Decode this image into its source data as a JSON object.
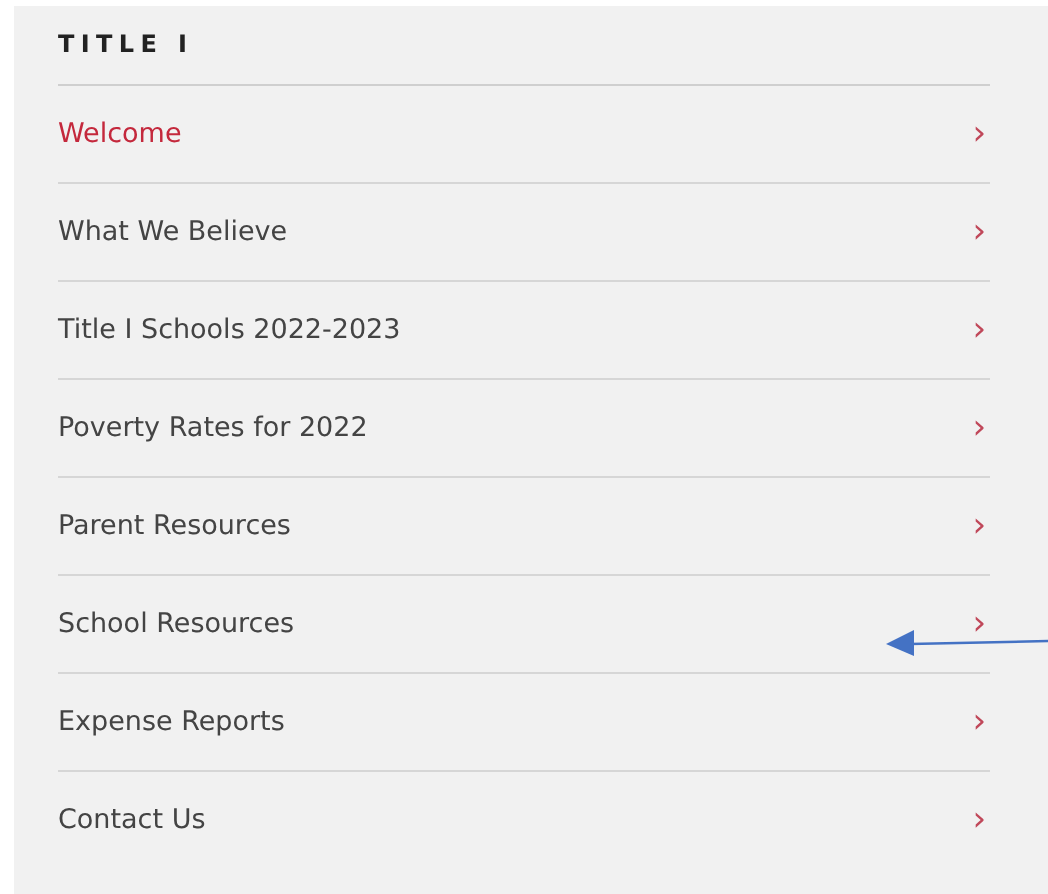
{
  "sidebar": {
    "title": "TITLE I",
    "items": [
      {
        "label": "Welcome",
        "selected": true,
        "chevron": "›"
      },
      {
        "label": "What We Believe",
        "selected": false,
        "chevron": "›"
      },
      {
        "label": "Title I Schools 2022-2023",
        "selected": false,
        "chevron": "›"
      },
      {
        "label": "Poverty Rates for 2022",
        "selected": false,
        "chevron": "›"
      },
      {
        "label": "Parent Resources",
        "selected": false,
        "chevron": "›"
      },
      {
        "label": "School Resources",
        "selected": false,
        "chevron": "›"
      },
      {
        "label": "Expense Reports",
        "selected": false,
        "chevron": "›"
      },
      {
        "label": "Contact Us",
        "selected": false,
        "chevron": "›"
      }
    ]
  }
}
